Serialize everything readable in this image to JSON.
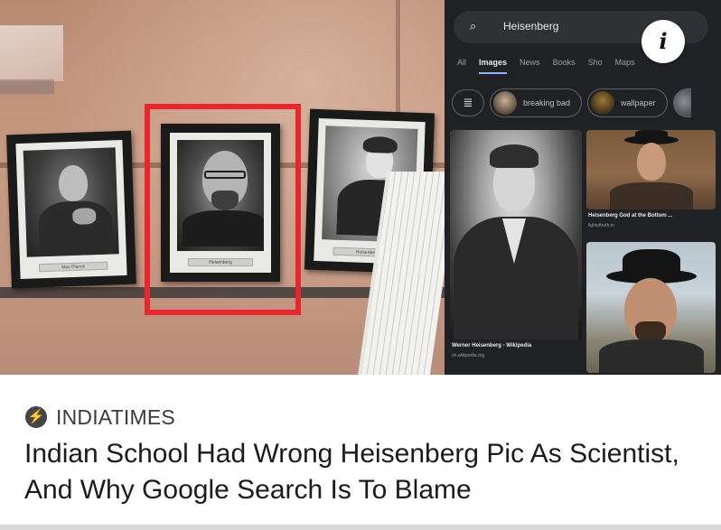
{
  "google": {
    "search_query": "Heisenberg",
    "tabs": [
      "All",
      "Images",
      "News",
      "Books",
      "Sho",
      "Maps"
    ],
    "active_tab": "Images",
    "chips": [
      "breaking bad",
      "wallpaper"
    ],
    "results": [
      {
        "title": "Werner Heisenberg - Wikipedia",
        "source": "en.wikipedia.org"
      },
      {
        "title": "Heisenberg God at the Bottom ...",
        "source": "lightoftruth.in"
      }
    ],
    "info_badge": "i"
  },
  "frames": {
    "left_plate": "Max Planck",
    "middle_plate": "Heisenberg",
    "right_plate": "Heisenberg"
  },
  "article": {
    "source": "INDIATIMES",
    "headline": "Indian School Had Wrong Heisenberg Pic As Scientist, And Why Google Search Is To Blame"
  },
  "colors": {
    "highlight_box": "#e8262c",
    "google_bg": "#202124",
    "tab_underline": "#8ab4f8"
  },
  "icons": {
    "source": "lightning-bolt-icon",
    "search": "search-icon",
    "filter": "tune-icon"
  }
}
